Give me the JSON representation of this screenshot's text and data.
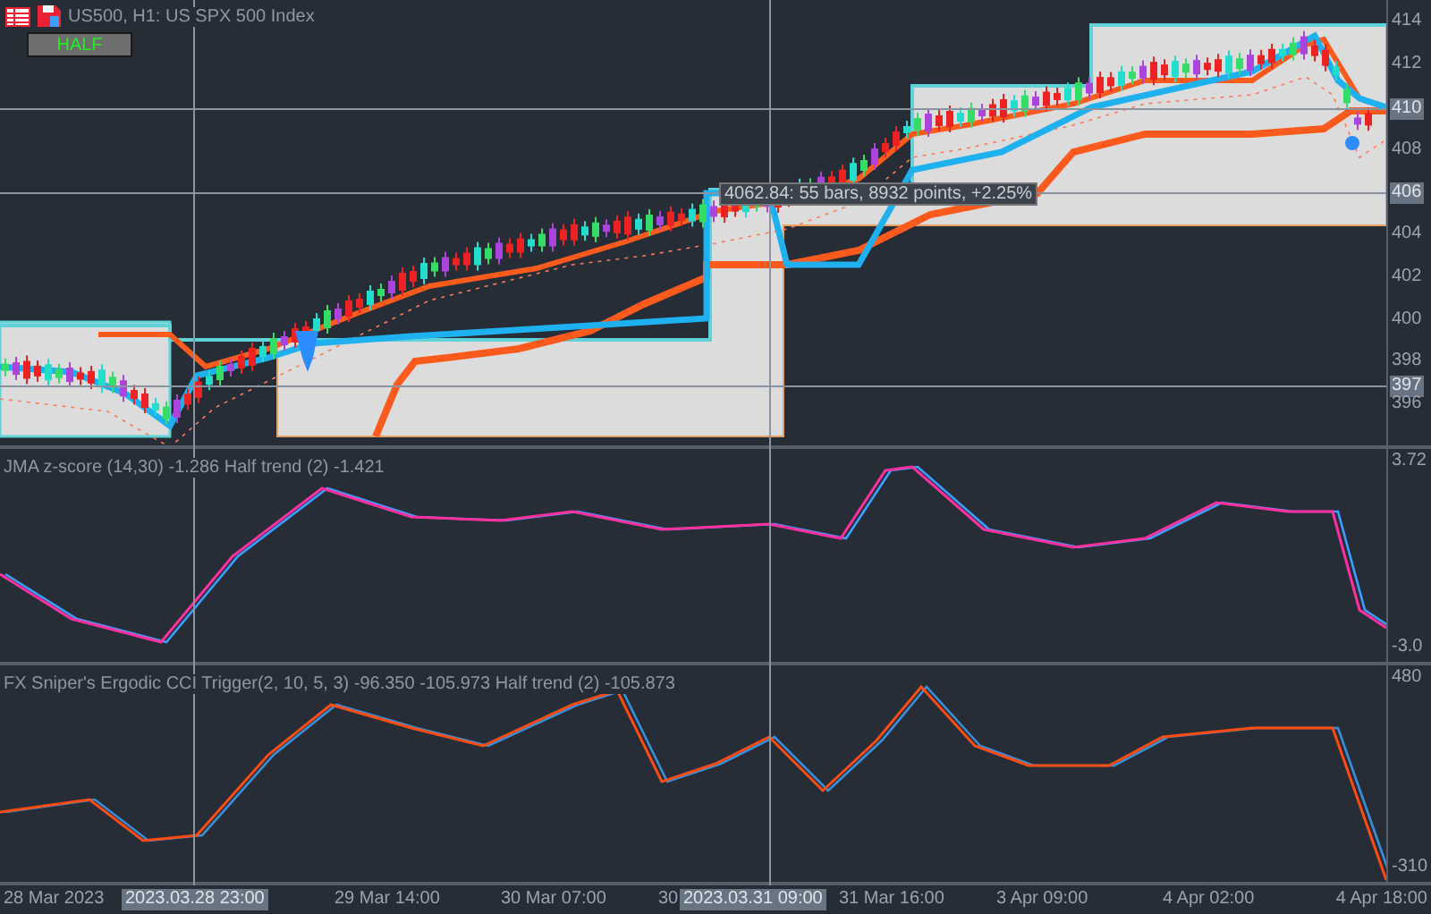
{
  "header": {
    "title": "US500, H1:  US SPX 500 Index",
    "button": "HALF"
  },
  "price_axis": [
    {
      "label": "414",
      "highlighted": false
    },
    {
      "label": "412",
      "highlighted": false
    },
    {
      "label": "410",
      "highlighted": true
    },
    {
      "label": "408",
      "highlighted": false
    },
    {
      "label": "406",
      "highlighted": true
    },
    {
      "label": "404",
      "highlighted": false
    },
    {
      "label": "402",
      "highlighted": false
    },
    {
      "label": "400",
      "highlighted": false
    },
    {
      "label": "398",
      "highlighted": false
    },
    {
      "label": "397",
      "highlighted": true
    },
    {
      "label": "396",
      "highlighted": false
    }
  ],
  "measure": {
    "text": "4062.84: 55 bars, 8932 points, +2.25%"
  },
  "panes": [
    {
      "title": "JMA z-score (14,30) -1.286 Half trend (2) -1.421",
      "axis": [
        "3.72",
        "-3.0"
      ]
    },
    {
      "title": "FX Sniper's Ergodic CCI Trigger(2, 10, 5, 3) -96.350 -105.973 Half trend (2) -105.873",
      "axis": [
        "480",
        "-310"
      ]
    }
  ],
  "time_axis": [
    {
      "label": "28 Mar 2023",
      "highlighted": false
    },
    {
      "label": "2023.03.28 23:00",
      "highlighted": true
    },
    {
      "label": "29 Mar 14:00",
      "highlighted": false
    },
    {
      "label": "30 Mar 07:00",
      "highlighted": false
    },
    {
      "label": "30",
      "highlighted": false
    },
    {
      "label": "2023.03.31 09:00",
      "highlighted": true
    },
    {
      "label": "31 Mar 16:00",
      "highlighted": false
    },
    {
      "label": "3 Apr 09:00",
      "highlighted": false
    },
    {
      "label": "4 Apr 02:00",
      "highlighted": false
    },
    {
      "label": "4 Apr 18:00",
      "highlighted": false
    }
  ]
}
